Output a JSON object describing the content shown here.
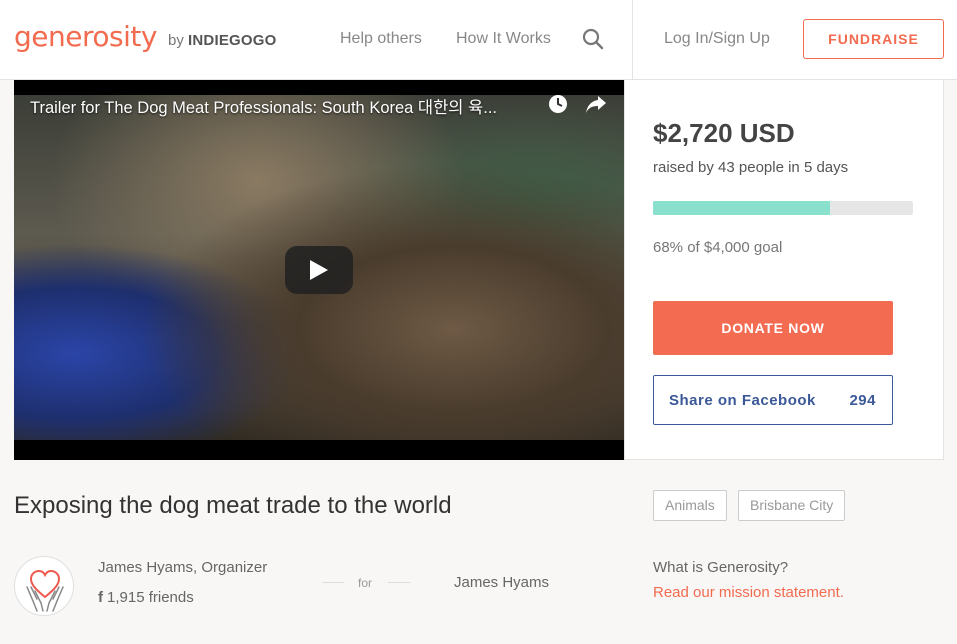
{
  "header": {
    "logo": "generosity",
    "by_prefix": "by",
    "by_brand": "INDIEGOGO",
    "nav": {
      "help_others": "Help others",
      "how_it_works": "How It Works",
      "login": "Log In/Sign Up"
    },
    "fundraise_label": "FUNDRAISE"
  },
  "video": {
    "title": "Trailer for The Dog Meat Professionals: South Korea 대한의 육..."
  },
  "campaign_card": {
    "amount": "$2,720 USD",
    "raised_text": "raised by 43 people in 5 days",
    "progress_fraction": 0.68,
    "goal_text": "68% of $4,000 goal",
    "donate_label": "DONATE NOW",
    "share_label": "Share on Facebook",
    "share_count": "294"
  },
  "campaign": {
    "title": "Exposing the dog meat trade to the world",
    "tags": [
      "Animals",
      "Brisbane City"
    ],
    "organizer_name": "James Hyams, Organizer",
    "friends_icon": "f",
    "friends_text": "1,915 friends",
    "for_text": "for",
    "beneficiary": "James Hyams"
  },
  "about": {
    "question": "What is Generosity?",
    "mission_link": "Read our mission statement."
  },
  "colors": {
    "brand": "#f26b4f",
    "donate": "#f36b51",
    "progress": "#88e0cd",
    "facebook": "#3b5998"
  }
}
